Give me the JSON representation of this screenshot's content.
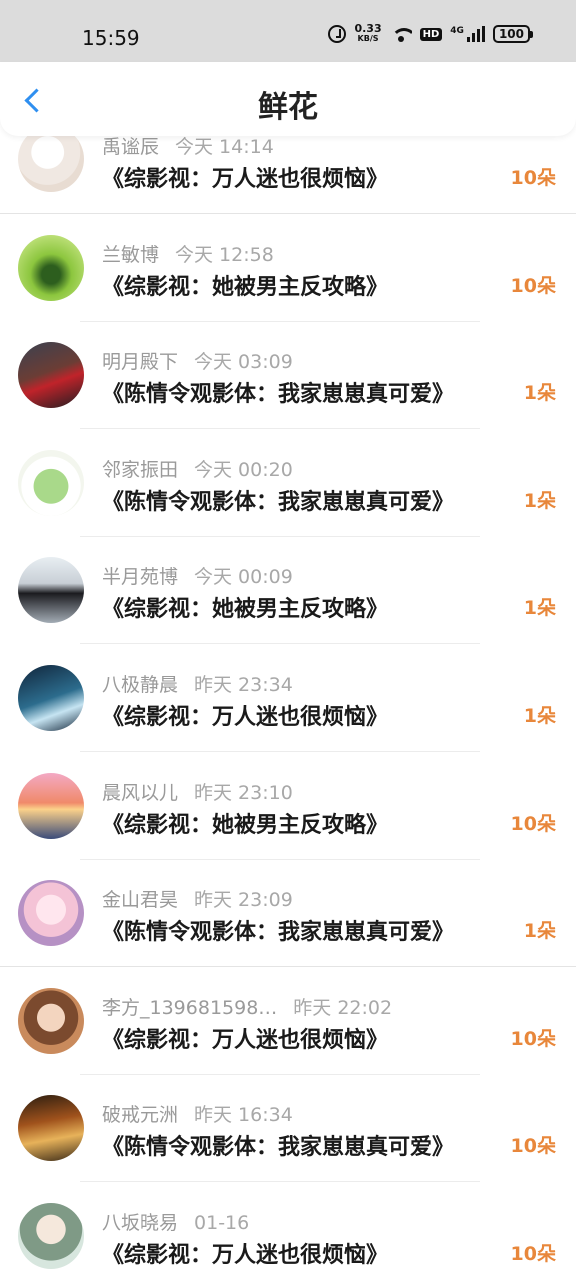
{
  "status_bar": {
    "time": "15:59",
    "net_speed_value": "0.33",
    "net_speed_unit": "KB/S",
    "hd_label": "HD",
    "signal_label": "4G",
    "battery": "100",
    "icons": [
      "alarm-icon",
      "wifi-icon",
      "signal-icon",
      "battery-icon"
    ]
  },
  "header": {
    "title": "鲜花",
    "back_icon": "chevron-left-icon"
  },
  "colors": {
    "accent": "#2f8ff0",
    "count_orange": "#e8873b",
    "meta_gray": "#9a9a9a"
  },
  "flowers": [
    {
      "user": "禹谧辰",
      "time": "今天 14:14",
      "book": "《综影视：万人迷也很烦恼》",
      "count": "10朵"
    },
    {
      "user": "兰敏博",
      "time": "今天 12:58",
      "book": "《综影视：她被男主反攻略》",
      "count": "10朵"
    },
    {
      "user": "明月殿下",
      "time": "今天 03:09",
      "book": "《陈情令观影体：我家崽崽真可爱》",
      "count": "1朵"
    },
    {
      "user": "邻家振田",
      "time": "今天 00:20",
      "book": "《陈情令观影体：我家崽崽真可爱》",
      "count": "1朵"
    },
    {
      "user": "半月苑博",
      "time": "今天 00:09",
      "book": "《综影视：她被男主反攻略》",
      "count": "1朵"
    },
    {
      "user": "八极静晨",
      "time": "昨天 23:34",
      "book": "《综影视：万人迷也很烦恼》",
      "count": "1朵"
    },
    {
      "user": "晨风以儿",
      "time": "昨天 23:10",
      "book": "《综影视：她被男主反攻略》",
      "count": "10朵"
    },
    {
      "user": "金山君昊",
      "time": "昨天 23:09",
      "book": "《陈情令观影体：我家崽崽真可爱》",
      "count": "1朵"
    },
    {
      "user": "李方_139681598…",
      "time": "昨天 22:02",
      "book": "《综影视：万人迷也很烦恼》",
      "count": "10朵"
    },
    {
      "user": "破戒元洲",
      "time": "昨天 16:34",
      "book": "《陈情令观影体：我家崽崽真可爱》",
      "count": "10朵"
    },
    {
      "user": "八坂晓易",
      "time": "01-16",
      "book": "《综影视：万人迷也很烦恼》",
      "count": "10朵"
    }
  ]
}
